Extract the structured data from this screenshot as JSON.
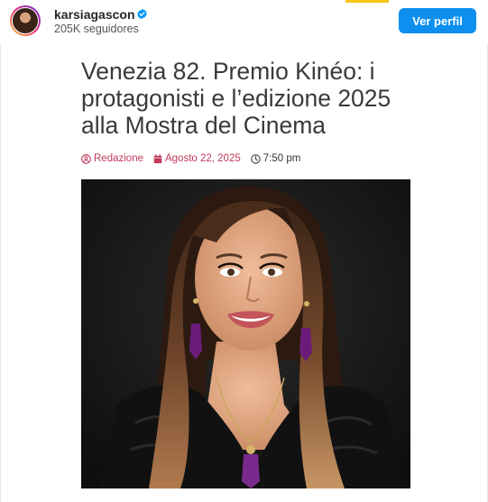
{
  "profile": {
    "username": "karsiagascon",
    "followers": "205K seguidores",
    "verified": true,
    "button_label": "Ver perfil"
  },
  "article": {
    "title": "Venezia 82. Premio Kinéo: i protagonisti e l’edizione 2025 alla Mostra del Cinema",
    "author": "Redazione",
    "date": "Agosto 22, 2025",
    "time": "7:50 pm"
  },
  "colors": {
    "button": "#0d8ff0",
    "meta_accent": "#c0395a",
    "title": "#3a3a3a"
  },
  "icons": [
    "verified-badge-icon",
    "user-icon",
    "calendar-icon",
    "clock-icon"
  ]
}
